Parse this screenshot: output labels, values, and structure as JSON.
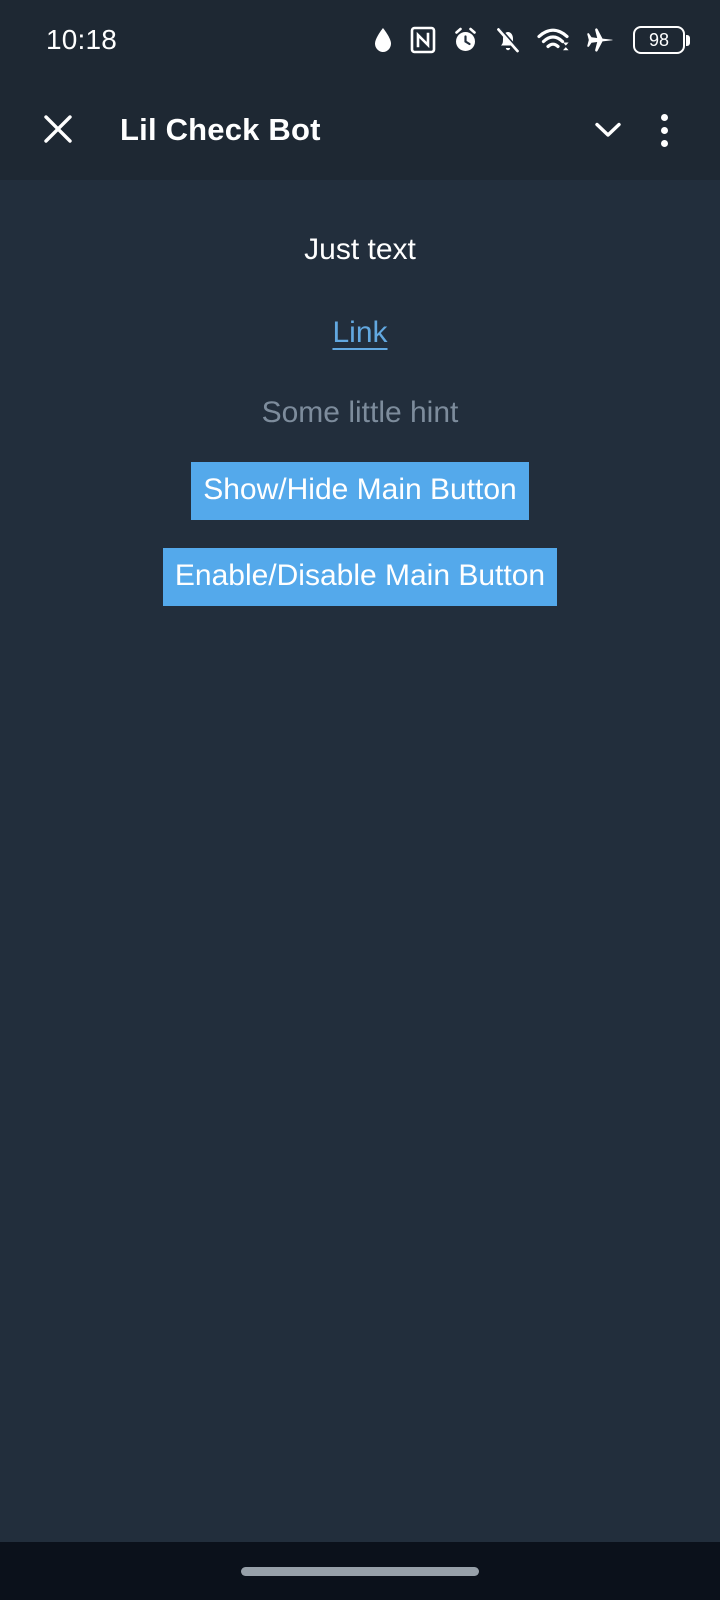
{
  "status_bar": {
    "time": "10:18",
    "icons": [
      "water-drop-icon",
      "nfc-icon",
      "alarm-clock-icon",
      "bell-muted-icon",
      "wifi-icon",
      "airplane-mode-icon"
    ],
    "battery_level": "98"
  },
  "header": {
    "close_label": "close-icon",
    "title": "Lil Check Bot",
    "collapse_label": "chevron-down-icon",
    "menu_label": "more-options-icon"
  },
  "webapp": {
    "plain_text": "Just text",
    "link_label": "Link",
    "hint": "Some little hint",
    "buttons": [
      {
        "label": "Show/Hide Main Button"
      },
      {
        "label": "Enable/Disable Main Button"
      }
    ]
  },
  "nav_bar": {
    "gesture_handle": "gesture-pill"
  },
  "colors": {
    "app_background": "#222e3c",
    "header_background": "#1e2833",
    "button_blue": "#54a9eb",
    "link_blue": "#62a8e0",
    "hint_gray": "#7d8c9c",
    "nav_background": "#0b111b"
  }
}
